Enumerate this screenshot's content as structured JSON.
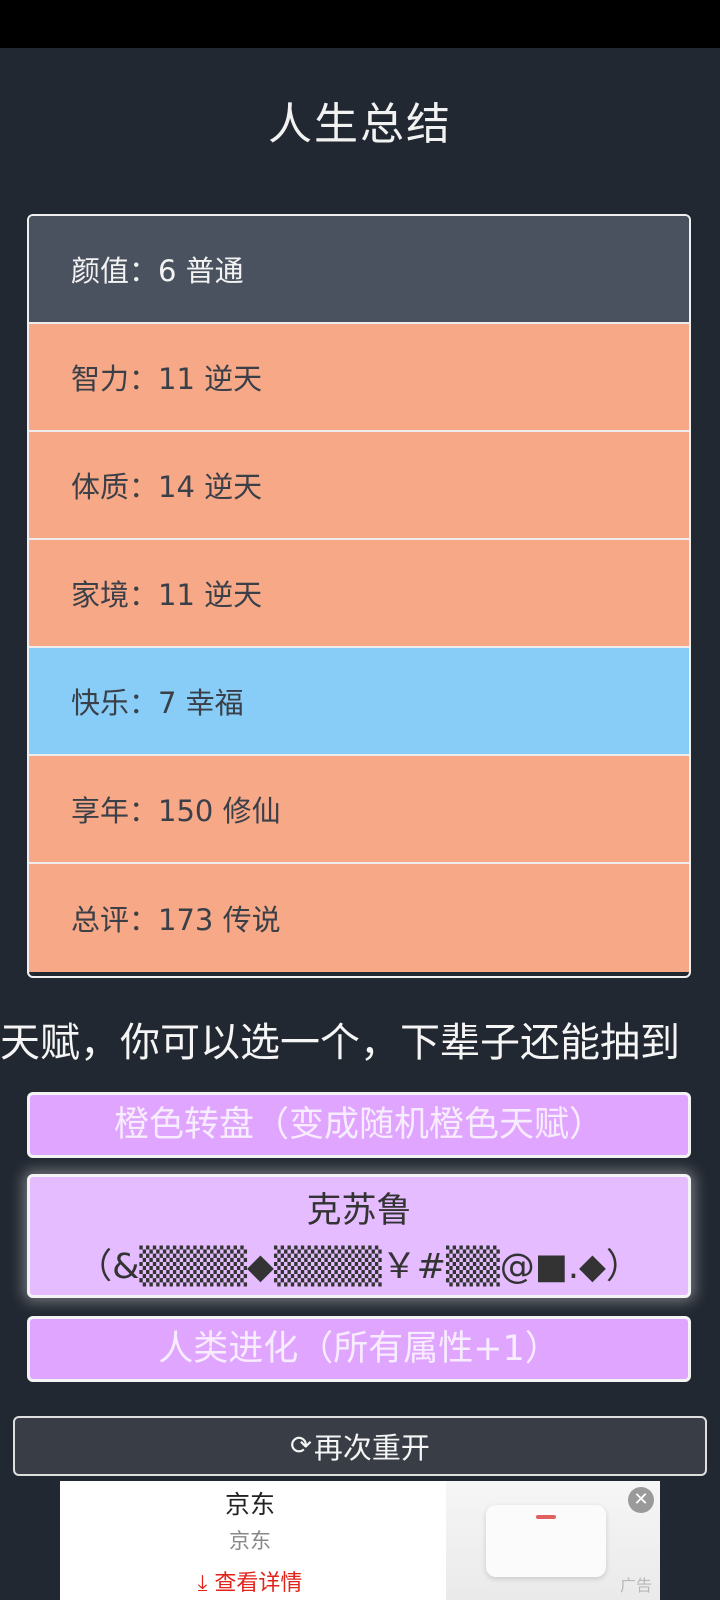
{
  "page": {
    "title": "人生总结"
  },
  "summary": {
    "rows": [
      {
        "label": "颜值：6 普通",
        "level": "gray"
      },
      {
        "label": "智力：11 逆天",
        "level": "orange"
      },
      {
        "label": "体质：14 逆天",
        "level": "orange"
      },
      {
        "label": "家境：11 逆天",
        "level": "orange"
      },
      {
        "label": "快乐：7 幸福",
        "level": "blue"
      },
      {
        "label": "享年：150 修仙",
        "level": "orange"
      },
      {
        "label": "总评：173 传说",
        "level": "orange"
      }
    ]
  },
  "talents": {
    "prompt": "天赋，你可以选一个，下辈子还能抽到",
    "options": [
      {
        "label": "橙色转盘（变成随机橙色天赋）",
        "selected": false
      },
      {
        "label_line1": "克苏鲁",
        "label_line2": "（&▒▒▒▒◆▒▒▒▒￥#▒▒@■.◆）",
        "selected": true
      },
      {
        "label": "人类进化（所有属性+1）",
        "selected": false
      }
    ]
  },
  "restart": {
    "icon": "refresh-icon",
    "label": "再次重开"
  },
  "ad": {
    "title": "京东",
    "subtitle": "京东",
    "cta": "查看详情",
    "cta_icon": "download-icon",
    "close_icon": "close-icon",
    "tag": "广告"
  },
  "colors": {
    "background": "#222831",
    "gray_row": "#4a525f",
    "orange_row": "#f6a887",
    "blue_row": "#87cdf7",
    "purple_talent": "#e0a6ff",
    "selected_talent": "#e4bcff"
  }
}
